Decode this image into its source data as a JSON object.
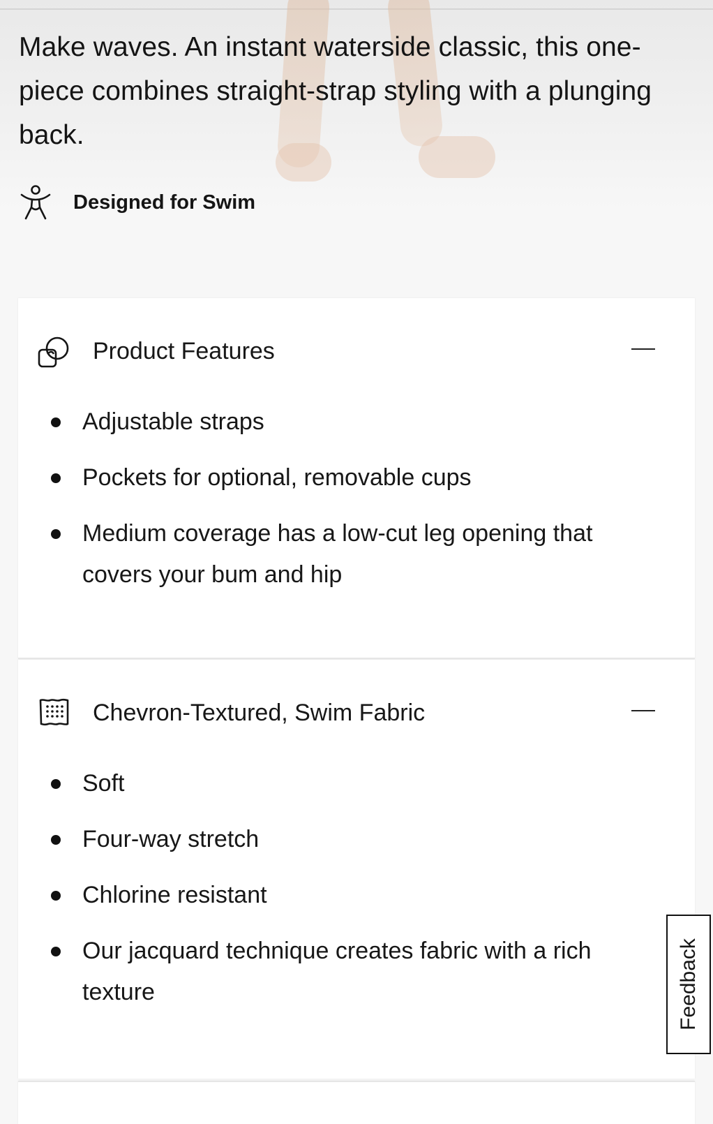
{
  "hero": {
    "description": "Make waves. An instant waterside classic, this one-piece combines straight-strap styling with a plunging back."
  },
  "designed_for": {
    "icon": "swimmer-icon",
    "label": "Designed for Swim"
  },
  "sections": [
    {
      "icon": "features-icon",
      "title": "Product Features",
      "toggle_icon": "minus-icon",
      "items": [
        "Adjustable straps",
        "Pockets for optional, removable cups",
        "Medium coverage has a low-cut leg opening that covers your bum and hip"
      ]
    },
    {
      "icon": "fabric-icon",
      "title": "Chevron-Textured, Swim Fabric",
      "toggle_icon": "minus-icon",
      "items": [
        "Soft",
        "Four-way stretch",
        "Chlorine resistant",
        "Our jacquard technique creates fabric with a rich texture"
      ]
    }
  ],
  "feedback": {
    "label": "Feedback"
  }
}
